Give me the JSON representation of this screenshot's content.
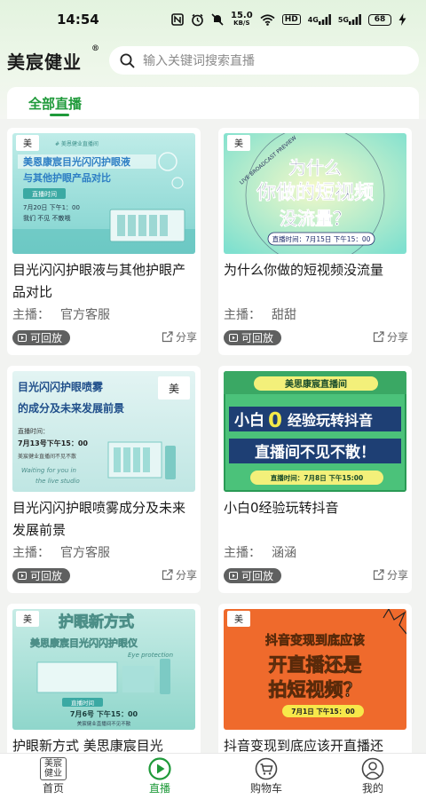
{
  "status_bar": {
    "time": "14:54",
    "speed": "15.0",
    "speed_unit": "KB/S",
    "hd": "HD",
    "net1": "4G",
    "net2": "5G",
    "battery": "68"
  },
  "header": {
    "logo": "美宸健业",
    "logo_mark": "®",
    "search_placeholder": "输入关键词搜索直播"
  },
  "tabs": {
    "all": "全部直播"
  },
  "cards": [
    {
      "title": "目光闪闪护眼液与其他护眼产品对比",
      "host_label": "主播：",
      "host": "官方客服",
      "replay": "可回放",
      "share": "分享",
      "poster": {
        "heading1": "美恩康宸目光闪闪护眼液",
        "heading2": "与其他护眼产品对比",
        "tag": "直播时间",
        "time": "7月20日 下午1：00",
        "slogan": "我们 不见 不散哦",
        "top": "# 美恩健业直播间"
      }
    },
    {
      "title": "为什么你做的短视频没流量",
      "host_label": "主播：",
      "host": "甜甜",
      "replay": "可回放",
      "share": "分享",
      "poster": {
        "line1": "为什么",
        "line2": "你做的短视频",
        "line3": "没流量？",
        "time": "直播时间：7月15日 下午15：00",
        "ring": "LIVE BROADCAST PREVIEW"
      }
    },
    {
      "title": "目光闪闪护眼喷雾成分及未来发展前景",
      "host_label": "主播：",
      "host": "官方客服",
      "replay": "可回放",
      "share": "分享",
      "poster": {
        "heading1": "目光闪闪护眼喷雾",
        "heading2": "的成分及未来发展前景",
        "tag": "直播时间：",
        "time": "7月13号下午15：00",
        "note": "美宸健业直播间不见不散",
        "script1": "Waiting for you in",
        "script2": "the live studio"
      }
    },
    {
      "title": "小白0经验玩转抖音",
      "host_label": "主播：",
      "host": "涵涵",
      "replay": "可回放",
      "share": "分享",
      "poster": {
        "top": "美思康宸直播间",
        "line1a": "小白",
        "line1b": "0",
        "line1c": "经验玩转抖音",
        "line2": "直播间不见不散！",
        "time": "直播时间：7月8日 下午15:00"
      }
    },
    {
      "title": "护眼新方式 美思康宸目光",
      "host_label": "",
      "host": "",
      "replay": "",
      "share": "",
      "poster": {
        "heading1": "护眼新方式",
        "heading2": "美思康宸目光闪闪护眼仪",
        "script": "Eye protection",
        "tag": "直播时间",
        "time": "7月6号 下午15：00",
        "note": "美宸健业直播间不见不散"
      }
    },
    {
      "title": "抖音变现到底应该开直播还",
      "host_label": "",
      "host": "",
      "replay": "",
      "share": "",
      "poster": {
        "line1": "抖音变现到底应该",
        "line2": "开直播还是",
        "line3": "拍短视频？",
        "time": "7月1日 下午15：00"
      }
    }
  ],
  "nav": [
    {
      "label": "首页",
      "icon": "home-logo-icon",
      "active": false
    },
    {
      "label": "直播",
      "icon": "play-circle-icon",
      "active": true
    },
    {
      "label": "购物车",
      "icon": "cart-icon",
      "active": false
    },
    {
      "label": "我的",
      "icon": "user-icon",
      "active": false
    }
  ],
  "colors": {
    "accent": "#1f9a3a",
    "replay_bg": "#5f6060"
  }
}
